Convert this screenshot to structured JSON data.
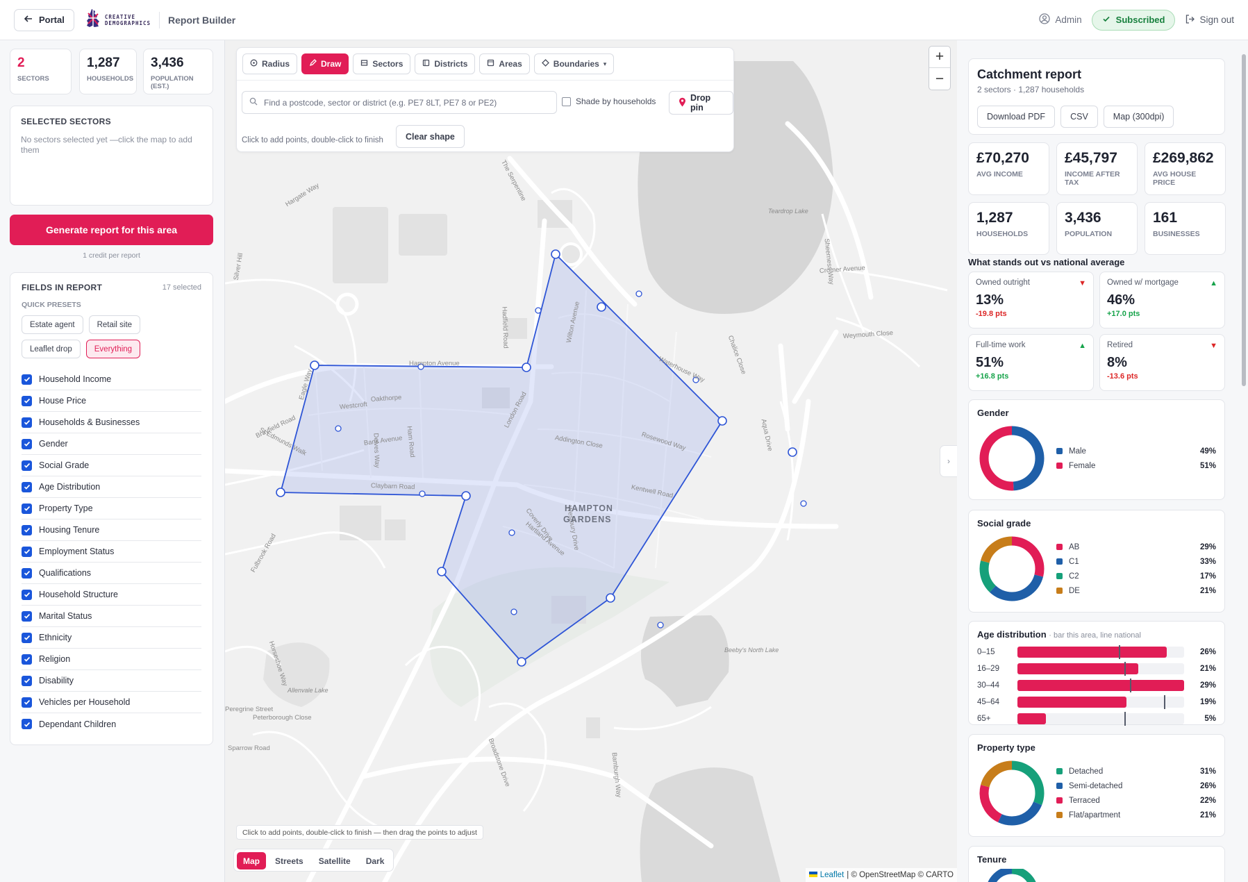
{
  "header": {
    "portal_label": "Portal",
    "logo_words": [
      "CREATIVE",
      "DEMOGRAPHICS"
    ],
    "app_name": "Report Builder",
    "user": "Admin",
    "status": "Subscribed",
    "signout": "Sign out"
  },
  "left": {
    "stats": [
      {
        "value": "2",
        "label": "Sectors"
      },
      {
        "value": "1,287",
        "label": "Households"
      },
      {
        "value": "3,436",
        "label": "Population (est.)"
      }
    ],
    "selected_title": "Selected sectors",
    "selected_empty": "No sectors selected yet —click the map to add them",
    "generate_label": "Generate report for this area",
    "credit_note": "1 credit per report",
    "fields_title": "Fields in report",
    "fields_count": "17 selected",
    "quick_presets_label": "Quick presets",
    "presets": [
      "Estate agent",
      "Retail site",
      "Leaflet drop",
      "Everything"
    ],
    "active_preset": "Everything",
    "fields": [
      "Household Income",
      "House Price",
      "Households & Businesses",
      "Gender",
      "Social Grade",
      "Age Distribution",
      "Property Type",
      "Housing Tenure",
      "Employment Status",
      "Qualifications",
      "Household Structure",
      "Marital Status",
      "Ethnicity",
      "Religion",
      "Disability",
      "Vehicles per Household",
      "Dependant Children"
    ]
  },
  "map": {
    "modes": [
      "Radius",
      "Draw",
      "Sectors",
      "Districts",
      "Areas",
      "Boundaries"
    ],
    "active_mode": "Draw",
    "search_placeholder": "Find a postcode, sector or district (e.g. PE7 8LT, PE7 8 or PE2)",
    "shade_label": "Shade by households",
    "drop_pin": "Drop pin",
    "draw_hint": "Click to add points, double-click to finish",
    "clear_shape": "Clear shape",
    "zoom_in": "+",
    "zoom_out": "−",
    "tip": "Click to add points, double-click to finish — then drag the points to adjust",
    "layers": [
      "Map",
      "Streets",
      "Satellite",
      "Dark"
    ],
    "active_layer": "Map",
    "attribution_link": "Leaflet",
    "attribution_rest": "| © OpenStreetMap © CARTO",
    "place_labels": {
      "area": [
        "HAMPTON",
        "GARDENS"
      ],
      "roads": [
        "Hampton Avenue",
        "London Road",
        "Claybarn Road",
        "Oakthorpe",
        "Westcroft",
        "Bank Avenue",
        "Ham Road",
        "Delves Way",
        "Hartland Avenue",
        "Westbury Drive",
        "Addington Close",
        "Rosewood Way",
        "Kentwell Road",
        "Waterhouse Way",
        "Aqua Drive",
        "The Serpentine",
        "Hargate Way",
        "Eagle Way",
        "Silver Hill",
        "St Edmunds Walk",
        "Horseshoe Way",
        "Peregrine Street",
        "Sparrow Road",
        "Hadfield Road",
        "Coverly Drive",
        "Wilton Avenue",
        "Cromer Avenue",
        "Weymouth Close",
        "Sheerness Way",
        "Chalice Close",
        "Brayfield Road",
        "Fulbrook Road",
        "Peterborough Close",
        "Broadstone Drive",
        "Bamburgh Way"
      ],
      "water": [
        "Teardrop Lake",
        "Beeby's North Lake",
        "Allenvale Lake"
      ]
    }
  },
  "report": {
    "title": "Catchment report",
    "subtitle": "2 sectors · 1,287 households",
    "buttons": [
      "Download PDF",
      "CSV",
      "Map (300dpi)"
    ],
    "kpis": [
      {
        "value": "£70,270",
        "label": "Avg income"
      },
      {
        "value": "£45,797",
        "label": "Income after tax"
      },
      {
        "value": "£269,862",
        "label": "Avg house price"
      },
      {
        "value": "1,287",
        "label": "Households"
      },
      {
        "value": "3,436",
        "label": "Population"
      },
      {
        "value": "161",
        "label": "Businesses"
      }
    ],
    "standout_title": "What stands out vs national average",
    "standouts": [
      {
        "label": "Owned outright",
        "value": "13%",
        "delta": "-19.8 pts",
        "direction": "down"
      },
      {
        "label": "Owned w/ mortgage",
        "value": "46%",
        "delta": "+17.0 pts",
        "direction": "up"
      },
      {
        "label": "Full-time work",
        "value": "51%",
        "delta": "+16.8 pts",
        "direction": "up"
      },
      {
        "label": "Retired",
        "value": "8%",
        "delta": "-13.6 pts",
        "direction": "down"
      }
    ],
    "gender": {
      "title": "Gender",
      "items": [
        {
          "label": "Male",
          "pct": "49%",
          "value": 49,
          "color": "#1f5fa8"
        },
        {
          "label": "Female",
          "pct": "51%",
          "value": 51,
          "color": "#e11d56"
        }
      ]
    },
    "social_grade": {
      "title": "Social grade",
      "items": [
        {
          "label": "AB",
          "pct": "29%",
          "value": 29,
          "color": "#e11d56"
        },
        {
          "label": "C1",
          "pct": "33%",
          "value": 33,
          "color": "#1f5fa8"
        },
        {
          "label": "C2",
          "pct": "17%",
          "value": 17,
          "color": "#16a07a"
        },
        {
          "label": "DE",
          "pct": "21%",
          "value": 21,
          "color": "#c77d1a"
        }
      ]
    },
    "age": {
      "title": "Age distribution",
      "hint": "· bar this area, line national",
      "rows": [
        {
          "label": "0–15",
          "pct": "26%",
          "value": 26,
          "national": 18
        },
        {
          "label": "16–29",
          "pct": "21%",
          "value": 21,
          "national": 19
        },
        {
          "label": "30–44",
          "pct": "29%",
          "value": 29,
          "national": 20
        },
        {
          "label": "45–64",
          "pct": "19%",
          "value": 19,
          "national": 26
        },
        {
          "label": "65+",
          "pct": "5%",
          "value": 5,
          "national": 19
        }
      ]
    },
    "property": {
      "title": "Property type",
      "items": [
        {
          "label": "Detached",
          "pct": "31%",
          "value": 31,
          "color": "#16a07a"
        },
        {
          "label": "Semi-detached",
          "pct": "26%",
          "value": 26,
          "color": "#1f5fa8"
        },
        {
          "label": "Terraced",
          "pct": "22%",
          "value": 22,
          "color": "#e11d56"
        },
        {
          "label": "Flat/apartment",
          "pct": "21%",
          "value": 21,
          "color": "#c77d1a"
        }
      ]
    },
    "tenure_title": "Tenure"
  }
}
